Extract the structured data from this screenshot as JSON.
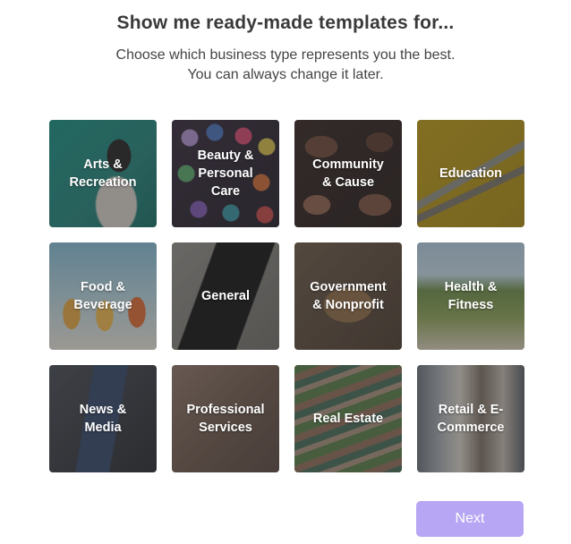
{
  "header": {
    "title": "Show me ready-made templates for...",
    "subtitle_line1": "Choose which business type represents you the best.",
    "subtitle_line2": "You can always change it later."
  },
  "categories": [
    {
      "label": "Arts &\nRecreation",
      "icon": "arts-photo"
    },
    {
      "label": "Beauty &\nPersonal\nCare",
      "icon": "beauty-photo"
    },
    {
      "label": "Community\n& Cause",
      "icon": "community-photo"
    },
    {
      "label": "Education",
      "icon": "education-photo"
    },
    {
      "label": "Food &\nBeverage",
      "icon": "food-photo"
    },
    {
      "label": "General",
      "icon": "general-photo"
    },
    {
      "label": "Government\n& Nonprofit",
      "icon": "government-photo"
    },
    {
      "label": "Health &\nFitness",
      "icon": "health-photo"
    },
    {
      "label": "News &\nMedia",
      "icon": "news-photo"
    },
    {
      "label": "Professional\nServices",
      "icon": "professional-photo"
    },
    {
      "label": "Real Estate",
      "icon": "realestate-photo"
    },
    {
      "label": "Retail & E-\nCommerce",
      "icon": "retail-photo"
    }
  ],
  "footer": {
    "next_label": "Next"
  },
  "colors": {
    "accent": "#b7a6f3",
    "title": "#3a3a3a",
    "text": "#444444"
  }
}
